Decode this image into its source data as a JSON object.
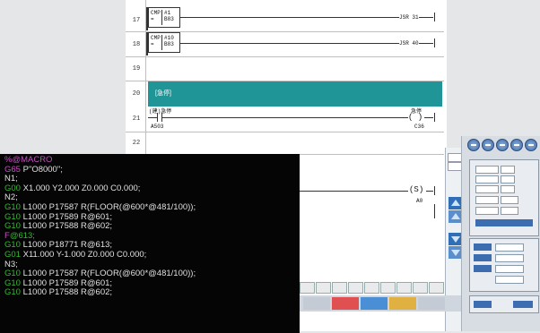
{
  "ladder": {
    "rungs": [
      {
        "num": "17"
      },
      {
        "num": "18"
      },
      {
        "num": "19"
      },
      {
        "num": "20"
      },
      {
        "num": "21"
      },
      {
        "num": "22"
      }
    ],
    "r17": {
      "instr": "CMP =",
      "op1": "#1",
      "op2": "B83",
      "coil": "JSR 31"
    },
    "r18": {
      "instr": "CMP =",
      "op1": "#10",
      "op2": "B83",
      "coil": "JSR 40"
    },
    "r20": {
      "comment": "[急停]"
    },
    "r21": {
      "left_label": "(建)急停",
      "left_addr": "A503",
      "right_label": "急停",
      "right_addr": "C36"
    },
    "r23": {
      "coil": "S",
      "addr": "A0"
    }
  },
  "code": {
    "lines": [
      {
        "a": "%@MACRO",
        "b": ""
      },
      {
        "a": "G65",
        "b": " P\"O8000\";"
      },
      {
        "a": "",
        "b": "N1;"
      },
      {
        "a": "G00",
        "b": " X1.000 Y2.000 Z0.000 C0.000;"
      },
      {
        "a": "",
        "b": "N2;"
      },
      {
        "a": "G10",
        "b": " L1000 P17587 R(FLOOR(@600*@481/100));"
      },
      {
        "a": "G10",
        "b": " L1000 P17589 R@601;"
      },
      {
        "a": "G10",
        "b": " L1000 P17588 R@602;"
      },
      {
        "a": "F",
        "b": "@613;"
      },
      {
        "a": "G10",
        "b": " L1000 P18771 R@613;"
      },
      {
        "a": "G01",
        "b": " X11.000 Y-1.000 Z0.000 C0.000;"
      },
      {
        "a": "",
        "b": "N3;"
      },
      {
        "a": "G10",
        "b": " L1000 P17587 R(FLOOR(@600*@481/100));"
      },
      {
        "a": "G10",
        "b": " L1000 P17589 R@601;"
      },
      {
        "a": "G10",
        "b": " L1000 P17588 R@602;"
      }
    ]
  },
  "colors": {
    "teal": "#1f9598",
    "code_bg": "#050505",
    "g_code": "#35b832",
    "macro": "#c64fc4"
  }
}
